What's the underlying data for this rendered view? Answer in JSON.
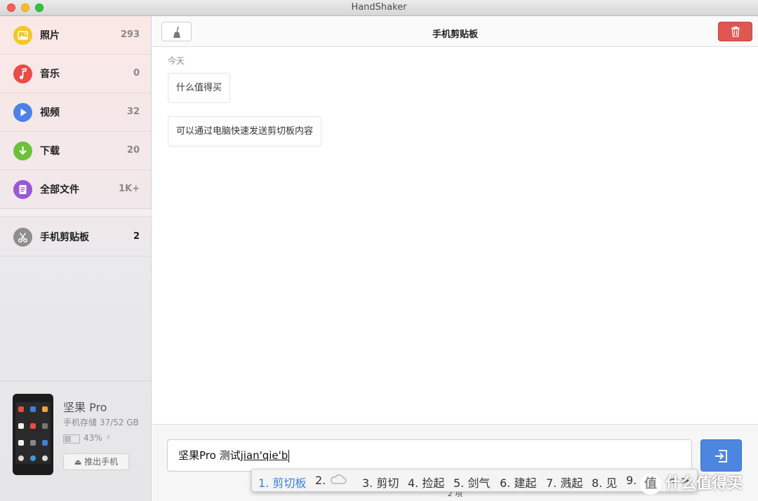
{
  "window": {
    "title": "HandShaker"
  },
  "sidebar": {
    "items": [
      {
        "label": "照片",
        "count": "293",
        "icon": "photo-icon",
        "color": "#f5c623"
      },
      {
        "label": "音乐",
        "count": "0",
        "icon": "music-icon",
        "color": "#ea4b44"
      },
      {
        "label": "视频",
        "count": "32",
        "icon": "play-icon",
        "color": "#4c82e8"
      },
      {
        "label": "下载",
        "count": "20",
        "icon": "download-icon",
        "color": "#6cc138"
      },
      {
        "label": "全部文件",
        "count": "1K+",
        "icon": "document-icon",
        "color": "#9b57d6"
      },
      {
        "label": "手机剪贴板",
        "count": "2",
        "icon": "scissors-icon",
        "color": "#8e8e8e",
        "active": true
      }
    ]
  },
  "device": {
    "name": "坚果 Pro",
    "storage": "手机存储 37/52 GB",
    "battery": "43%",
    "battery_level": 0.43,
    "eject_label": "推出手机"
  },
  "toolbar": {
    "title": "手机剪贴板"
  },
  "clipboard": {
    "date_label": "今天",
    "entries": [
      "什么值得买",
      "可以通过电脑快速发送剪切板内容"
    ]
  },
  "input": {
    "typed": "坚果Pro 测试",
    "composing": "jian'qie'b"
  },
  "status": {
    "count_text": "2 项"
  },
  "ime": {
    "candidates": [
      "1. 剪切板",
      "2.",
      "3. 剪切",
      "4. 捡起",
      "5. 剑气",
      "6. 建起",
      "7. 溅起",
      "8. 见",
      "9."
    ],
    "arrows": "< >"
  },
  "watermark": {
    "badge": "值",
    "text": "什么值得买"
  },
  "colors": {
    "accent": "#4d86e0",
    "danger": "#e05652",
    "selected_candidate": "#3a80db"
  }
}
